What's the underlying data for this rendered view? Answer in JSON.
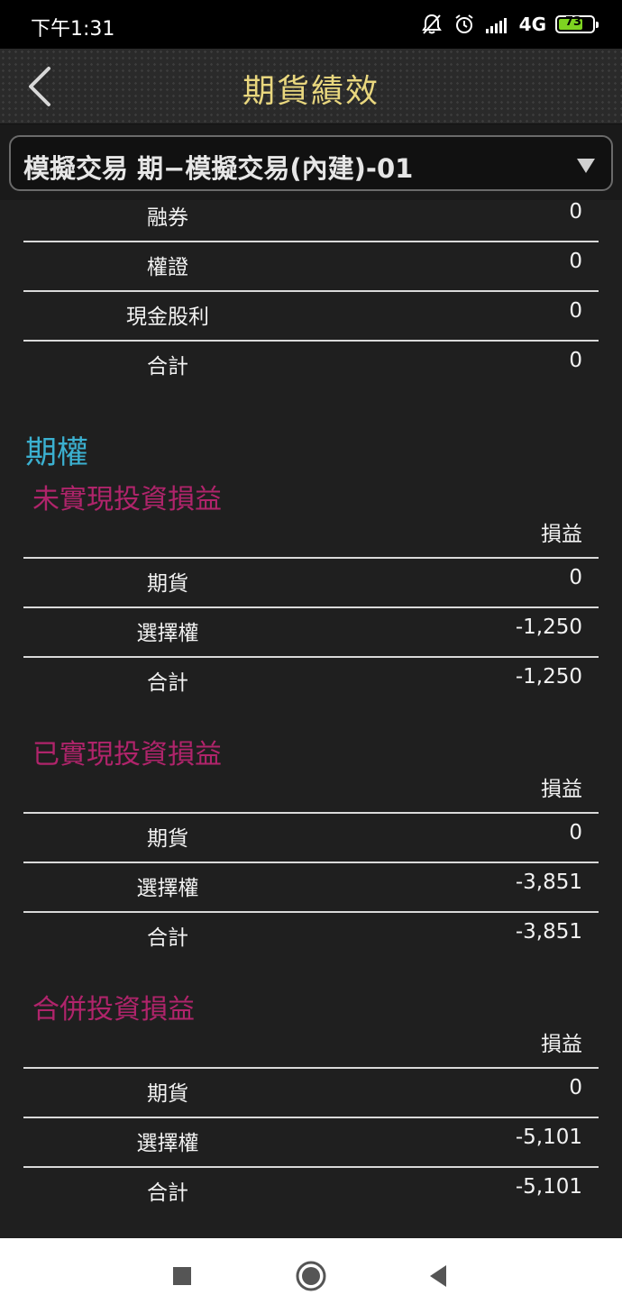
{
  "status_bar": {
    "time": "下午1:31",
    "network": "4G",
    "battery_percent": 73,
    "battery_label": "73"
  },
  "header": {
    "title": "期貨績效"
  },
  "account": {
    "selected": "模擬交易 期−模擬交易(內建)-01"
  },
  "stock_section_rows": [
    {
      "label": "融券",
      "value": "0"
    },
    {
      "label": "權證",
      "value": "0"
    },
    {
      "label": "現金股利",
      "value": "0"
    },
    {
      "label": "合計",
      "value": "0"
    }
  ],
  "options_section": {
    "title": "期權",
    "groups": [
      {
        "title": "未實現投資損益",
        "column_header": "損益",
        "rows": [
          {
            "label": "期貨",
            "value": "0"
          },
          {
            "label": "選擇權",
            "value": "-1,250"
          },
          {
            "label": "合計",
            "value": "-1,250"
          }
        ]
      },
      {
        "title": "已實現投資損益",
        "column_header": "損益",
        "rows": [
          {
            "label": "期貨",
            "value": "0"
          },
          {
            "label": "選擇權",
            "value": "-3,851"
          },
          {
            "label": "合計",
            "value": "-3,851"
          }
        ]
      },
      {
        "title": "合併投資損益",
        "column_header": "損益",
        "rows": [
          {
            "label": "期貨",
            "value": "0"
          },
          {
            "label": "選擇權",
            "value": "-5,101"
          },
          {
            "label": "合計",
            "value": "-5,101"
          }
        ]
      }
    ]
  },
  "colors": {
    "title_gold": "#e9d77e",
    "section_blue": "#3bb0d0",
    "subtitle_magenta": "#b0246b",
    "battery_green": "#7ed321"
  },
  "bottom_nav": {
    "icons": [
      "square-icon",
      "circle-home-icon",
      "triangle-back-icon"
    ]
  }
}
